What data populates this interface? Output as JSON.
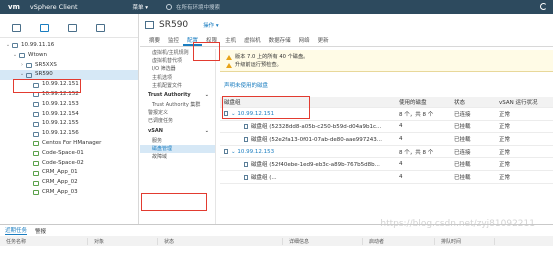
{
  "topbar": {
    "logo": "vm",
    "app": "vSphere Client",
    "menu": "菜单 ▾",
    "search_placeholder": "在所有环境中搜索"
  },
  "tree": [
    {
      "label": "10.99.11.16",
      "indent": 0,
      "chev": "⌄",
      "type": "vc"
    },
    {
      "label": "Wtown",
      "indent": 1,
      "chev": "⌄",
      "type": "dc"
    },
    {
      "label": "SR5XXS",
      "indent": 2,
      "chev": "›",
      "type": "cl"
    },
    {
      "label": "SR590",
      "indent": 2,
      "chev": "⌄",
      "type": "cl",
      "selected": true
    },
    {
      "label": "10.99.12.151",
      "indent": 3,
      "chev": "",
      "type": "host"
    },
    {
      "label": "10.99.12.152",
      "indent": 3,
      "chev": "",
      "type": "host"
    },
    {
      "label": "10.99.12.153",
      "indent": 3,
      "chev": "",
      "type": "host"
    },
    {
      "label": "10.99.12.154",
      "indent": 3,
      "chev": "",
      "type": "host"
    },
    {
      "label": "10.99.12.155",
      "indent": 3,
      "chev": "",
      "type": "host"
    },
    {
      "label": "10.99.12.156",
      "indent": 3,
      "chev": "",
      "type": "host"
    },
    {
      "label": "Centos For HManager",
      "indent": 3,
      "chev": "",
      "type": "vm"
    },
    {
      "label": "Code-Space-01",
      "indent": 3,
      "chev": "",
      "type": "vm"
    },
    {
      "label": "Code-Space-02",
      "indent": 3,
      "chev": "",
      "type": "vm"
    },
    {
      "label": "CRM_App_01",
      "indent": 3,
      "chev": "",
      "type": "vm"
    },
    {
      "label": "CRM_App_02",
      "indent": 3,
      "chev": "",
      "type": "vm"
    },
    {
      "label": "CRM_App_03",
      "indent": 3,
      "chev": "",
      "type": "vm"
    }
  ],
  "main": {
    "title": "SR590",
    "actions": "操作 ▾",
    "tabs": [
      "摘要",
      "监控",
      "配置",
      "权限",
      "主机",
      "虚拟机",
      "数据存储",
      "网络",
      "更新"
    ],
    "active_tab": 2
  },
  "subnav": [
    {
      "label": "虚拟机/主机规则",
      "kind": "item"
    },
    {
      "label": "虚拟机替代项",
      "kind": "item"
    },
    {
      "label": "I/O 筛选器",
      "kind": "item"
    },
    {
      "label": "主机选项",
      "kind": "item"
    },
    {
      "label": "主机配置文件",
      "kind": "item"
    },
    {
      "label": "Trust Authority",
      "kind": "head"
    },
    {
      "label": "Trust Authority 集群",
      "kind": "item"
    },
    {
      "label": "警报定义",
      "kind": "plain"
    },
    {
      "label": "已调度任务",
      "kind": "plain"
    },
    {
      "label": "vSAN",
      "kind": "head"
    },
    {
      "label": "服务",
      "kind": "item"
    },
    {
      "label": "磁盘管理",
      "kind": "item",
      "active": true
    },
    {
      "label": "故障域",
      "kind": "item"
    }
  ],
  "alerts": [
    "版本 7.0 上的所有 40 个磁盘。",
    "升级前运行预检查。"
  ],
  "unused_link": "声明未使用的磁盘",
  "grid": {
    "headers": [
      "磁盘组",
      "使用的磁盘",
      "状态",
      "vSAN 运行状况"
    ],
    "rows": [
      {
        "kind": "host-row",
        "cells": [
          "⌄  10.99.12.151",
          "8 个，共 8 个",
          "已连接",
          "正常"
        ]
      },
      {
        "kind": "disk-row",
        "cells": [
          "磁盘组 (52328dd8-a05b-c250-b59d-d04a9b1c...",
          "4",
          "已挂载",
          "正常"
        ]
      },
      {
        "kind": "disk-row",
        "cells": [
          "磁盘组 (52e2fa13-0f01-07ab-de80-aae997243...",
          "4",
          "已挂载",
          "正常"
        ]
      },
      {
        "kind": "host-row",
        "cells": [
          "⌄  10.99.12.153",
          "8 个，共 8 个",
          "已连接",
          "正常"
        ]
      },
      {
        "kind": "disk-row",
        "cells": [
          "磁盘组 (52f40ebe-1ed9-eb3c-a89b-767b5d8b...",
          "4",
          "已挂载",
          "正常"
        ]
      },
      {
        "kind": "disk-row",
        "cells": [
          "磁盘组 (...",
          "4",
          "已挂载",
          "正常"
        ]
      }
    ]
  },
  "bottom": {
    "tabs": [
      "近期任务",
      "警报"
    ],
    "columns": [
      "任务名称",
      "对象",
      "状态",
      "详细信息",
      "启动者",
      "排队时间"
    ]
  },
  "watermark": "https://blog.csdn.net/zyj81092211"
}
